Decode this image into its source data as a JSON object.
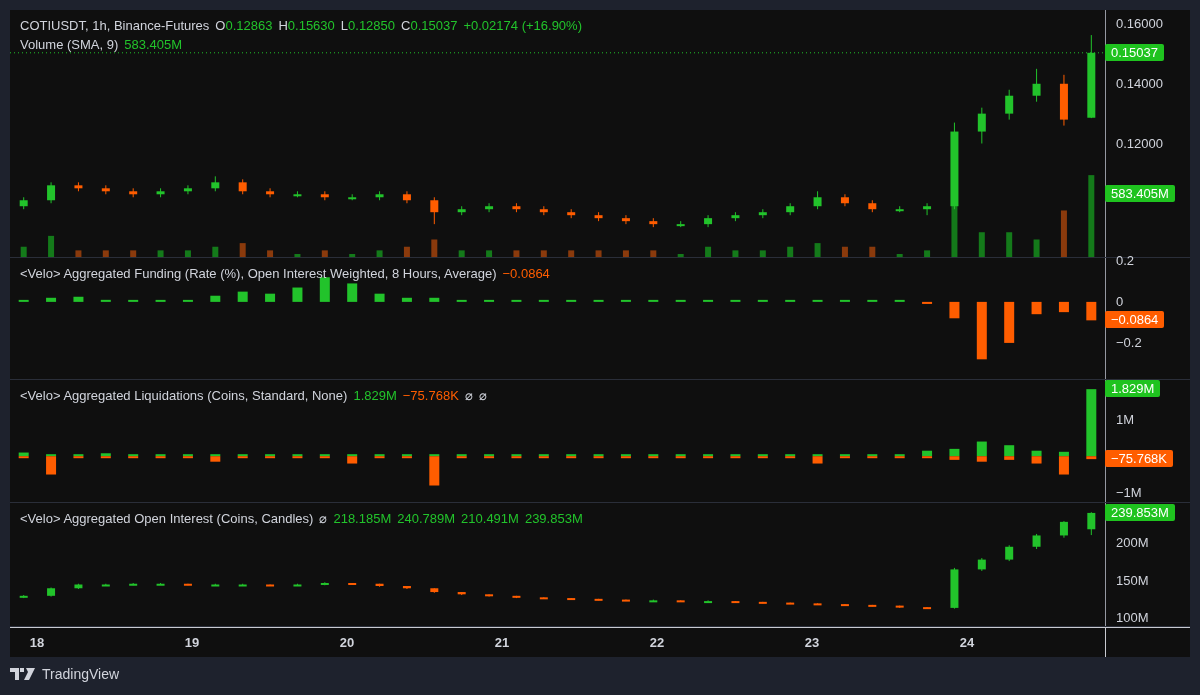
{
  "panes": [
    {
      "kind": "price",
      "legends": [
        {
          "title": "COTIUSDT, 1h, Binance-Futures",
          "fields": [
            {
              "label": "O",
              "value": "0.12863",
              "color": "#22c32b"
            },
            {
              "label": "H",
              "value": "0.15630",
              "color": "#22c32b"
            },
            {
              "label": "L",
              "value": "0.12850",
              "color": "#22c32b"
            },
            {
              "label": "C",
              "value": "0.15037",
              "color": "#22c32b"
            }
          ],
          "values": [
            {
              "text": "+0.02174 (+16.90%)",
              "color": "#22c32b"
            }
          ]
        },
        {
          "title": "Volume (SMA, 9)",
          "values": [
            {
              "text": "583.405M",
              "color": "#22c32b"
            }
          ]
        }
      ],
      "badges": [
        {
          "kind": "last",
          "text": "0.15037",
          "color": "#1fc31f"
        },
        {
          "kind": "volume",
          "text": "583.405M",
          "color": "#1fc31f"
        }
      ],
      "chart_data": {
        "type": "candlestick",
        "ylim": [
          0.082,
          0.1647
        ],
        "yticks": [
          {
            "value": 0.16,
            "label": "0.16000"
          },
          {
            "value": 0.14,
            "label": "0.14000"
          },
          {
            "value": 0.12,
            "label": "0.12000"
          }
        ],
        "categories": [
          null,
          null,
          null,
          null,
          null,
          null,
          null,
          null,
          null,
          null,
          null,
          null,
          null,
          null,
          null,
          null,
          null,
          null,
          null,
          null,
          null,
          null,
          null,
          null,
          null,
          null,
          null,
          null,
          null,
          null,
          null,
          null,
          null,
          null,
          null,
          null,
          null,
          null,
          null,
          null
        ],
        "ohlc": [
          [
            0.099,
            0.102,
            0.098,
            0.101
          ],
          [
            0.101,
            0.107,
            0.1,
            0.106
          ],
          [
            0.106,
            0.107,
            0.104,
            0.105
          ],
          [
            0.105,
            0.106,
            0.103,
            0.104
          ],
          [
            0.104,
            0.105,
            0.102,
            0.103
          ],
          [
            0.103,
            0.105,
            0.102,
            0.104
          ],
          [
            0.104,
            0.106,
            0.103,
            0.105
          ],
          [
            0.105,
            0.109,
            0.104,
            0.107
          ],
          [
            0.107,
            0.108,
            0.103,
            0.104
          ],
          [
            0.104,
            0.105,
            0.102,
            0.103
          ],
          [
            0.103,
            0.104,
            0.102,
            0.103
          ],
          [
            0.103,
            0.104,
            0.101,
            0.102
          ],
          [
            0.102,
            0.103,
            0.101,
            0.102
          ],
          [
            0.102,
            0.104,
            0.101,
            0.103
          ],
          [
            0.103,
            0.104,
            0.1,
            0.101
          ],
          [
            0.101,
            0.102,
            0.093,
            0.097
          ],
          [
            0.097,
            0.099,
            0.096,
            0.098
          ],
          [
            0.098,
            0.1,
            0.097,
            0.099
          ],
          [
            0.099,
            0.1,
            0.097,
            0.098
          ],
          [
            0.098,
            0.099,
            0.096,
            0.097
          ],
          [
            0.097,
            0.098,
            0.095,
            0.096
          ],
          [
            0.096,
            0.097,
            0.094,
            0.095
          ],
          [
            0.095,
            0.096,
            0.093,
            0.094
          ],
          [
            0.094,
            0.095,
            0.092,
            0.093
          ],
          [
            0.093,
            0.094,
            0.092,
            0.093
          ],
          [
            0.093,
            0.096,
            0.092,
            0.095
          ],
          [
            0.095,
            0.097,
            0.094,
            0.096
          ],
          [
            0.096,
            0.098,
            0.095,
            0.097
          ],
          [
            0.097,
            0.1,
            0.096,
            0.099
          ],
          [
            0.099,
            0.104,
            0.098,
            0.102
          ],
          [
            0.102,
            0.103,
            0.099,
            0.1
          ],
          [
            0.1,
            0.101,
            0.097,
            0.098
          ],
          [
            0.098,
            0.099,
            0.097,
            0.098
          ],
          [
            0.098,
            0.1,
            0.096,
            0.099
          ],
          [
            0.099,
            0.127,
            0.098,
            0.124
          ],
          [
            0.124,
            0.132,
            0.12,
            0.13
          ],
          [
            0.13,
            0.138,
            0.128,
            0.136
          ],
          [
            0.136,
            0.145,
            0.134,
            0.14
          ],
          [
            0.14,
            0.143,
            0.126,
            0.128
          ],
          [
            0.12863,
            0.1563,
            0.1285,
            0.15037
          ]
        ]
      }
    },
    {
      "kind": "funding",
      "legends": [
        {
          "title": "<Velo> Aggregated Funding (Rate (%), Open Interest Weighted, 8 Hours, Average)",
          "values": [
            {
              "text": "−0.0864",
              "color": "#ff5d00"
            }
          ]
        }
      ],
      "badges": [
        {
          "kind": "last",
          "text": "−0.0864",
          "color": "#ff5d00"
        }
      ],
      "chart_data": {
        "type": "bar",
        "ylim": [
          -0.376,
          0.214
        ],
        "yticks": [
          {
            "value": 0.2,
            "label": "0.2"
          },
          {
            "value": 0,
            "label": "0"
          },
          {
            "value": -0.2,
            "label": "−0.2"
          }
        ],
        "categories": [
          null,
          null,
          null,
          null,
          null,
          null,
          null,
          null,
          null,
          null,
          null,
          null,
          null,
          null,
          null,
          null,
          null,
          null,
          null,
          null,
          null,
          null,
          null,
          null,
          null,
          null,
          null,
          null,
          null,
          null,
          null,
          null,
          null,
          null,
          null,
          null,
          null,
          null,
          null,
          null
        ],
        "series": [
          {
            "color": "#22c32b",
            "values": [
              0.005,
              0.02,
              0.025,
              0.01,
              0.005,
              0.005,
              0.005,
              0.03,
              0.05,
              0.04,
              0.07,
              0.12,
              0.09,
              0.04,
              0.02,
              0.02,
              0.005,
              0.005,
              0.005,
              0.005,
              0.005,
              0.005,
              0.005,
              0.005,
              0.005,
              0.005,
              0.005,
              0.005,
              0.005,
              0.005,
              0.005,
              0.005,
              0.005,
              null,
              null,
              null,
              null,
              null,
              null,
              null
            ]
          },
          {
            "color": "#ff5d00",
            "values": [
              null,
              null,
              null,
              null,
              null,
              null,
              null,
              null,
              null,
              null,
              null,
              null,
              null,
              null,
              null,
              null,
              null,
              null,
              null,
              null,
              null,
              null,
              null,
              null,
              null,
              null,
              null,
              null,
              null,
              null,
              null,
              null,
              null,
              -0.01,
              -0.08,
              -0.28,
              -0.2,
              -0.06,
              -0.05,
              -0.09
            ]
          }
        ]
      }
    },
    {
      "kind": "liquidations",
      "legends": [
        {
          "title": "<Velo> Aggregated Liquidations (Coins, Standard, None)",
          "values": [
            {
              "text": "1.829M",
              "color": "#22c32b"
            },
            {
              "text": "−75.768K",
              "color": "#ff5d00"
            },
            {
              "text": "⌀"
            },
            {
              "text": "⌀"
            }
          ]
        }
      ],
      "badges": [
        {
          "kind": "last-up",
          "text": "1.829M",
          "color": "#1fc31f"
        },
        {
          "kind": "last-down",
          "text": "−75.768K",
          "color": "#ff5d00"
        }
      ],
      "chart_data": {
        "type": "bar",
        "ylim": [
          -1.25,
          2.08
        ],
        "yticks": [
          {
            "value": 1,
            "label": "1M"
          },
          {
            "value": -1,
            "label": "−1M"
          }
        ],
        "categories": [
          null,
          null,
          null,
          null,
          null,
          null,
          null,
          null,
          null,
          null,
          null,
          null,
          null,
          null,
          null,
          null,
          null,
          null,
          null,
          null,
          null,
          null,
          null,
          null,
          null,
          null,
          null,
          null,
          null,
          null,
          null,
          null,
          null,
          null,
          null,
          null,
          null,
          null,
          null,
          null
        ],
        "series": [
          {
            "color": "#22c32b",
            "values": [
              0.1,
              0.05,
              0.02,
              0.08,
              0.02,
              0.02,
              0.02,
              0.02,
              0.02,
              0.02,
              0.02,
              0.02,
              0.02,
              0.02,
              0.02,
              0.02,
              0.02,
              0.02,
              0.02,
              0.02,
              0.02,
              0.02,
              0.02,
              0.02,
              0.02,
              0.02,
              0.02,
              0.02,
              0.02,
              0.02,
              0.02,
              0.02,
              0.02,
              0.15,
              0.2,
              0.4,
              0.3,
              0.15,
              0.12,
              1.83
            ]
          },
          {
            "color": "#ff5d00",
            "values": [
              -0.02,
              -0.5,
              -0.02,
              -0.02,
              -0.02,
              -0.02,
              -0.02,
              -0.15,
              -0.02,
              -0.02,
              -0.02,
              -0.02,
              -0.2,
              -0.02,
              -0.02,
              -0.8,
              -0.02,
              -0.02,
              -0.02,
              -0.02,
              -0.02,
              -0.02,
              -0.02,
              -0.02,
              -0.02,
              -0.02,
              -0.02,
              -0.02,
              -0.02,
              -0.2,
              -0.02,
              -0.02,
              -0.02,
              -0.05,
              -0.1,
              -0.15,
              -0.1,
              -0.2,
              -0.5,
              -0.08
            ]
          }
        ]
      }
    },
    {
      "kind": "open-interest",
      "legends": [
        {
          "title": "<Velo> Aggregated Open Interest (Coins, Candles)",
          "values": [
            {
              "text": "⌀"
            },
            {
              "text": "218.185M",
              "color": "#22c32b"
            },
            {
              "text": "240.789M",
              "color": "#22c32b"
            },
            {
              "text": "210.491M",
              "color": "#22c32b"
            },
            {
              "text": "239.853M",
              "color": "#22c32b"
            }
          ]
        }
      ],
      "badges": [
        {
          "kind": "last",
          "text": "239.853M",
          "color": "#1fc31f"
        }
      ],
      "chart_data": {
        "type": "candlestick",
        "ylim": [
          90,
          253
        ],
        "yticks": [
          {
            "value": 200,
            "label": "200M"
          },
          {
            "value": 150,
            "label": "150M"
          },
          {
            "value": 100,
            "label": "100M"
          }
        ],
        "categories": [
          null,
          null,
          null,
          null,
          null,
          null,
          null,
          null,
          null,
          null,
          null,
          null,
          null,
          null,
          null,
          null,
          null,
          null,
          null,
          null,
          null,
          null,
          null,
          null,
          null,
          null,
          null,
          null,
          null,
          null,
          null,
          null,
          null,
          null,
          null,
          null,
          null,
          null,
          null,
          null
        ],
        "ohlc": [
          [
            128,
            131,
            127,
            130
          ],
          [
            130,
            141,
            129,
            140
          ],
          [
            140,
            146,
            139,
            145
          ],
          [
            145,
            146,
            144,
            145
          ],
          [
            145,
            147,
            144,
            146
          ],
          [
            146,
            147,
            145,
            146
          ],
          [
            146,
            146,
            144,
            145
          ],
          [
            145,
            146,
            144,
            145
          ],
          [
            145,
            146,
            144,
            145
          ],
          [
            145,
            145,
            143,
            144
          ],
          [
            144,
            146,
            143,
            145
          ],
          [
            145,
            148,
            144,
            147
          ],
          [
            147,
            147,
            145,
            146
          ],
          [
            146,
            146,
            142,
            143
          ],
          [
            143,
            143,
            139,
            140
          ],
          [
            140,
            140,
            134,
            135
          ],
          [
            135,
            135,
            131,
            132
          ],
          [
            132,
            132,
            129,
            130
          ],
          [
            130,
            130,
            127,
            128
          ],
          [
            128,
            128,
            126,
            127
          ],
          [
            127,
            127,
            125,
            126
          ],
          [
            126,
            126,
            124,
            125
          ],
          [
            125,
            125,
            123,
            124
          ],
          [
            124,
            125,
            123,
            124
          ],
          [
            124,
            124,
            122,
            123
          ],
          [
            123,
            124,
            122,
            123
          ],
          [
            123,
            123,
            121,
            122
          ],
          [
            122,
            122,
            120,
            121
          ],
          [
            121,
            121,
            119,
            120
          ],
          [
            120,
            120,
            118,
            119
          ],
          [
            119,
            119,
            117,
            118
          ],
          [
            118,
            118,
            116,
            117
          ],
          [
            117,
            117,
            114,
            115
          ],
          [
            115,
            115,
            113,
            114
          ],
          [
            114,
            167,
            113,
            165
          ],
          [
            165,
            180,
            163,
            178
          ],
          [
            178,
            197,
            176,
            195
          ],
          [
            195,
            212,
            192,
            210
          ],
          [
            210,
            229,
            207,
            228
          ],
          [
            218.185,
            240.789,
            210.491,
            239.853
          ]
        ]
      }
    }
  ],
  "time_axis": {
    "labels": [
      "18",
      "19",
      "20",
      "21",
      "22",
      "23",
      "24"
    ]
  },
  "brand": "TradingView"
}
